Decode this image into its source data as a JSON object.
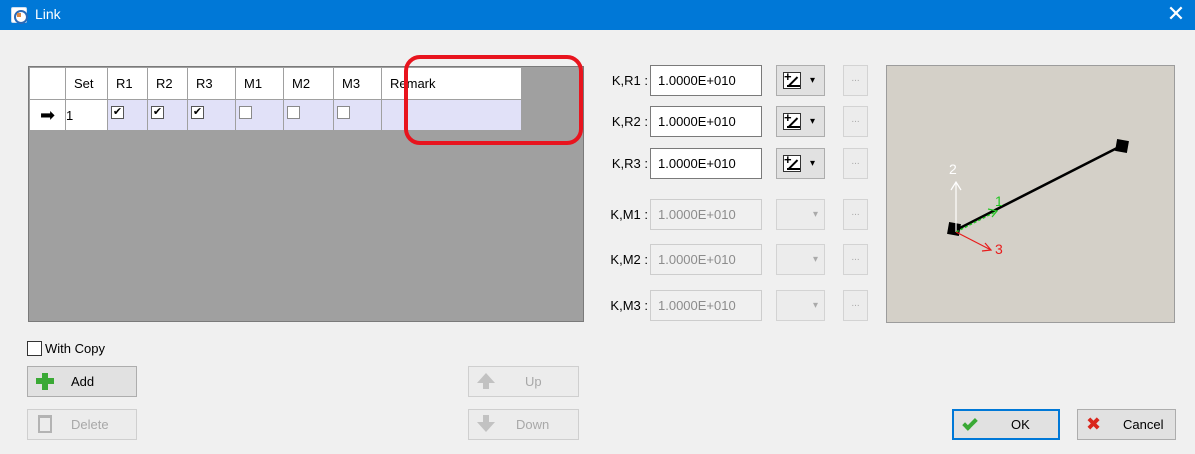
{
  "window": {
    "title": "Link",
    "close_glyph": "✕",
    "app_icon": "link-app-icon"
  },
  "grid": {
    "columns": [
      "Set",
      "R1",
      "R2",
      "R3",
      "M1",
      "M2",
      "M3",
      "Remark"
    ],
    "rows": [
      {
        "pointer": "➡",
        "set": "1",
        "R1": true,
        "R2": true,
        "R3": true,
        "M1": false,
        "M2": false,
        "M3": false,
        "remark": ""
      }
    ],
    "check_glyph": "✔"
  },
  "with_copy": {
    "label": "With Copy",
    "checked": false
  },
  "buttons": {
    "add": "Add",
    "delete": "Delete",
    "up": "Up",
    "down": "Down",
    "ok": "OK",
    "cancel": "Cancel"
  },
  "stiffness": [
    {
      "label": "K,R1 :",
      "value": "1.0000E+010",
      "enabled": true
    },
    {
      "label": "K,R2 :",
      "value": "1.0000E+010",
      "enabled": true
    },
    {
      "label": "K,R3 :",
      "value": "1.0000E+010",
      "enabled": true
    },
    {
      "label": "K,M1 :",
      "value": "1.0000E+010",
      "enabled": false
    },
    {
      "label": "K,M2 :",
      "value": "1.0000E+010",
      "enabled": false
    },
    {
      "label": "K,M3 :",
      "value": "1.0000E+010",
      "enabled": false
    }
  ],
  "more_glyph": "...",
  "caret_glyph": "▾",
  "preview": {
    "axis_labels": [
      "1",
      "2",
      "3"
    ],
    "axis_colors": {
      "1": "#22c322",
      "2": "#ffffff",
      "3": "#e81c1c"
    }
  },
  "colors": {
    "title_bar": "#0078d7",
    "highlight": "#e8141e",
    "row_fill": "#e1e1f8",
    "grid_bg": "#a0a0a0",
    "preview_bg": "#d4d0c8"
  }
}
